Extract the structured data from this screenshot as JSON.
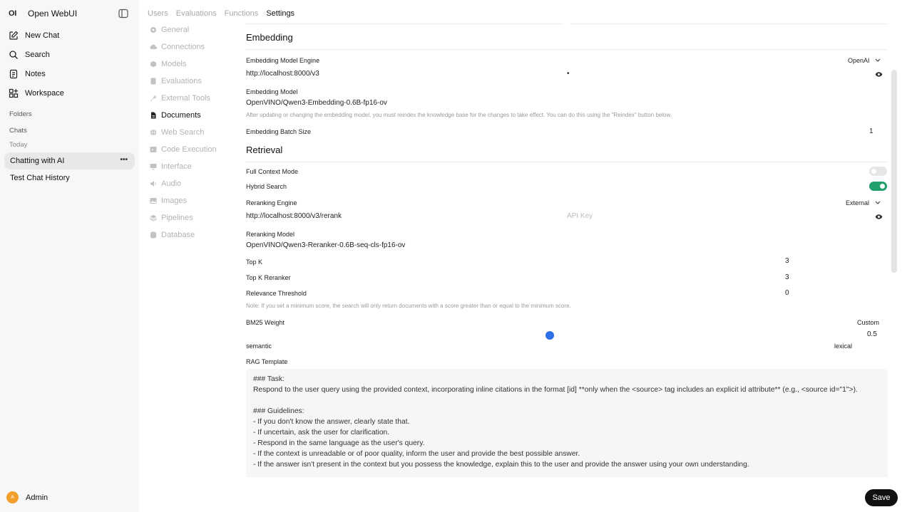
{
  "sidebar": {
    "brand_logo": "OI",
    "brand_name": "Open WebUI",
    "nav": {
      "new_chat": "New Chat",
      "search": "Search",
      "notes": "Notes",
      "workspace": "Workspace"
    },
    "folders_label": "Folders",
    "chats_label": "Chats",
    "today_label": "Today",
    "chats": [
      "Chatting with AI",
      "Test Chat History"
    ],
    "user": {
      "initial": "A",
      "name": "Admin"
    }
  },
  "tabs": [
    "Users",
    "Evaluations",
    "Functions",
    "Settings"
  ],
  "active_tab": "Settings",
  "settings_nav": [
    "General",
    "Connections",
    "Models",
    "Evaluations",
    "External Tools",
    "Documents",
    "Web Search",
    "Code Execution",
    "Interface",
    "Audio",
    "Images",
    "Pipelines",
    "Database"
  ],
  "active_settings": "Documents",
  "embedding": {
    "heading": "Embedding",
    "engine_label": "Embedding Model Engine",
    "engine_value": "OpenAI",
    "url": "http://localhost:8000/v3",
    "key_mask": "•",
    "model_label": "Embedding Model",
    "model_value": "OpenVINO/Qwen3-Embedding-0.6B-fp16-ov",
    "model_note": "After updating or changing the embedding model, you must reindex the knowledge base for the changes to take effect. You can do this using the \"Reindex\" button below.",
    "batch_label": "Embedding Batch Size",
    "batch_value": "1"
  },
  "retrieval": {
    "heading": "Retrieval",
    "full_context_label": "Full Context Mode",
    "full_context_on": false,
    "hybrid_label": "Hybrid Search",
    "hybrid_on": true,
    "rerank_engine_label": "Reranking Engine",
    "rerank_engine_value": "External",
    "rerank_url": "http://localhost:8000/v3/rerank",
    "api_key_placeholder": "API Key",
    "rerank_model_label": "Reranking Model",
    "rerank_model_value": "OpenVINO/Qwen3-Reranker-0.6B-seq-cls-fp16-ov",
    "topk_label": "Top K",
    "topk_value": "3",
    "topk_reranker_label": "Top K Reranker",
    "topk_reranker_value": "3",
    "relevance_label": "Relevance Threshold",
    "relevance_value": "0",
    "relevance_note": "Note: If you set a minimum score, the search will only return documents with a score greater than or equal to the minimum score.",
    "bm25_label": "BM25 Weight",
    "bm25_mode": "Custom",
    "bm25_value": "0.5",
    "bm25_fraction": 0.5,
    "bm25_left": "semantic",
    "bm25_right": "lexical",
    "rag_label": "RAG Template",
    "rag_template": "### Task:\nRespond to the user query using the provided context, incorporating inline citations in the format [id] **only when the <source> tag includes an explicit id attribute** (e.g., <source id=\"1\">).\n\n### Guidelines:\n- If you don't know the answer, clearly state that.\n- If uncertain, ask the user for clarification.\n- Respond in the same language as the user's query.\n- If the context is unreadable or of poor quality, inform the user and provide the best possible answer.\n- If the answer isn't present in the context but you possess the knowledge, explain this to the user and provide the answer using your own understanding."
  },
  "save_label": "Save",
  "colors": {
    "accent_toggle": "#22a06b",
    "slider": "#2f6fe8",
    "avatar": "#f29f2b"
  }
}
